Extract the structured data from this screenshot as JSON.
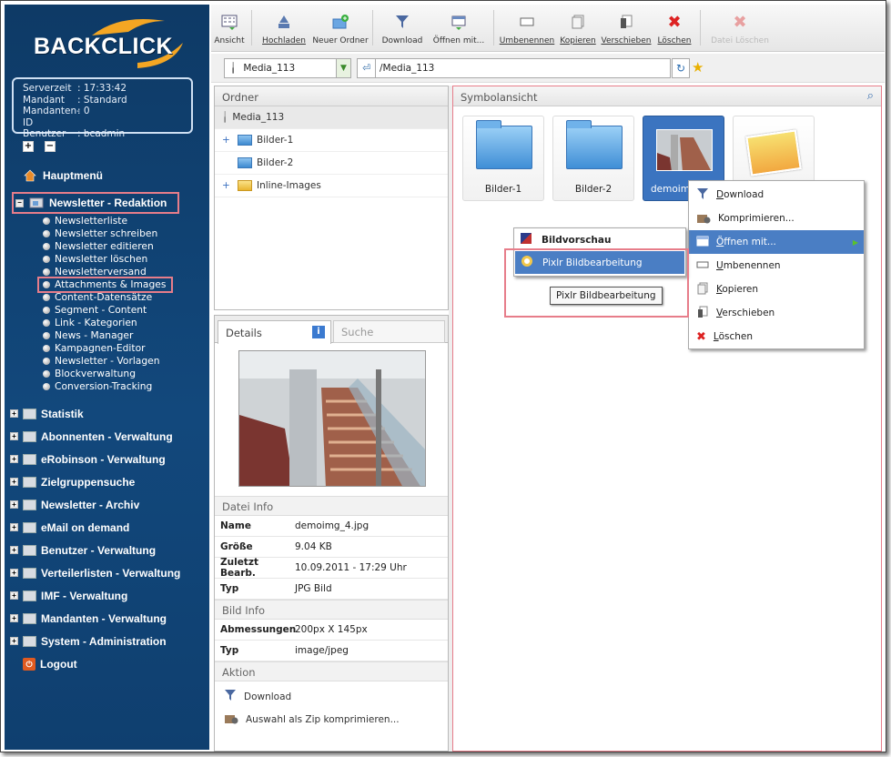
{
  "logo": {
    "text": "BACKCLICK"
  },
  "server": {
    "rows": [
      {
        "k": "Serverzeit",
        "v": ": 17:33:42"
      },
      {
        "k": "Mandant",
        "v": ": Standard"
      },
      {
        "k": "Mandanten-ID",
        "v": ": 0"
      },
      {
        "k": "Benutzer",
        "v": ": bcadmin"
      }
    ]
  },
  "nav": {
    "main": "Hauptmenü",
    "section": "Newsletter - Redaktion",
    "items": [
      "Newsletterliste",
      "Newsletter schreiben",
      "Newsletter editieren",
      "Newsletter löschen",
      "Newsletterversand",
      "Attachments & Images",
      "Content-Datensätze",
      "Segment - Content",
      "Link - Kategorien",
      "News - Manager",
      "Kampagnen-Editor",
      "Newsletter - Vorlagen",
      "Blockverwaltung",
      "Conversion-Tracking"
    ],
    "groups": [
      "Statistik",
      "Abonnenten - Verwaltung",
      "eRobinson - Verwaltung",
      "Zielgruppensuche",
      "Newsletter - Archiv",
      "eMail on demand",
      "Benutzer - Verwaltung",
      "Verteilerlisten - Verwaltung",
      "IMF - Verwaltung",
      "Mandanten - Verwaltung",
      "System - Administration"
    ],
    "logout": "Logout"
  },
  "toolbar": {
    "ansicht": "Ansicht",
    "hochladen": "Hochladen",
    "neuer_ordner": "Neuer Ordner",
    "download": "Download",
    "oeffnen": "Öffnen mit...",
    "umbenennen": "Umbenennen",
    "kopieren": "Kopieren",
    "verschieben": "Verschieben",
    "loeschen": "Löschen",
    "datei_loeschen": "Datei Löschen"
  },
  "pathbar": {
    "source": "Media_113",
    "path": "/Media_113"
  },
  "ordner": {
    "title": "Ordner",
    "root": "Media_113",
    "folders": [
      "Bilder-1",
      "Bilder-2",
      "Inline-Images"
    ]
  },
  "details": {
    "tab_details": "Details",
    "tab_suche": "Suche",
    "datei_info": "Datei Info",
    "file": [
      {
        "k": "Name",
        "v": "demoimg_4.jpg"
      },
      {
        "k": "Größe",
        "v": "9.04 KB"
      },
      {
        "k": "Zuletzt Bearb.",
        "v": "10.09.2011 - 17:29 Uhr"
      },
      {
        "k": "Typ",
        "v": "JPG Bild"
      }
    ],
    "bild_info": "Bild Info",
    "image": [
      {
        "k": "Abmessungen",
        "v": "200px X 145px"
      },
      {
        "k": "Typ",
        "v": "image/jpeg"
      }
    ],
    "aktion": "Aktion",
    "actions": [
      "Download",
      "Auswahl als Zip komprimieren..."
    ]
  },
  "symbol": {
    "title": "Symbolansicht",
    "tiles": [
      "Bilder-1",
      "Bilder-2",
      "demoimg"
    ]
  },
  "context1": {
    "header": "Bildvorschau",
    "item": "Pixlr Bildbearbeitung",
    "tooltip": "Pixlr Bildbearbeitung"
  },
  "context2": {
    "items": [
      "Download",
      "Komprimieren...",
      "Öffnen mit...",
      "Umbenennen",
      "Kopieren",
      "Verschieben",
      "Löschen"
    ]
  }
}
